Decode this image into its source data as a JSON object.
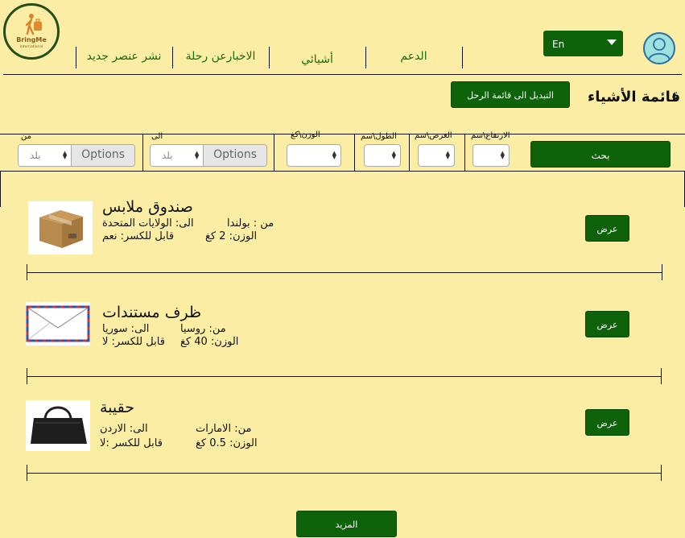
{
  "header": {
    "logo": {
      "title": "BringMe",
      "subtitle": "International"
    },
    "nav": [
      "نشر عنصر جديد",
      "الاخبارعن رحلة",
      "أشيائي",
      "الدعم"
    ],
    "language": "En"
  },
  "page": {
    "title": "قائمة الأشياء",
    "colon": ":",
    "switch_button": "التبديل الى قائمة الرحل"
  },
  "filters": {
    "height_label": "الارتفاع\\سم",
    "width_label": "العرض\\سم",
    "length_label": "الطول\\سم",
    "weight_label": "الوزن\\كغ",
    "to_label": "الى",
    "from_label": "من",
    "country_placeholder": "بلد",
    "options_label": "Options",
    "search_button": "بحث"
  },
  "items": [
    {
      "name": "صندوق ملابس",
      "from": "من : بولندا",
      "to": "الى: الولايات المتحدة",
      "weight": "الوزن: 2 كغ",
      "fragile": "قابل للكسر: نعم",
      "view": "عرض"
    },
    {
      "name": "ظرف مستندات",
      "from": "من: روسيا",
      "to": "الى: سوريا",
      "weight": "الوزن: 40 كغ",
      "fragile": "قابل للكسر: لا",
      "view": "عرض"
    },
    {
      "name": "حقيبة",
      "from": "من: الامارات",
      "to": "الى: الاردن",
      "weight": "الوزن: 0.5 كغ",
      "fragile": "قابل للكسر :لا",
      "view": "عرض"
    }
  ],
  "more_button": "المزيد",
  "colors": {
    "background": "#fbeea4",
    "primary": "#0e620a",
    "nav_text": "#1b6b12"
  }
}
